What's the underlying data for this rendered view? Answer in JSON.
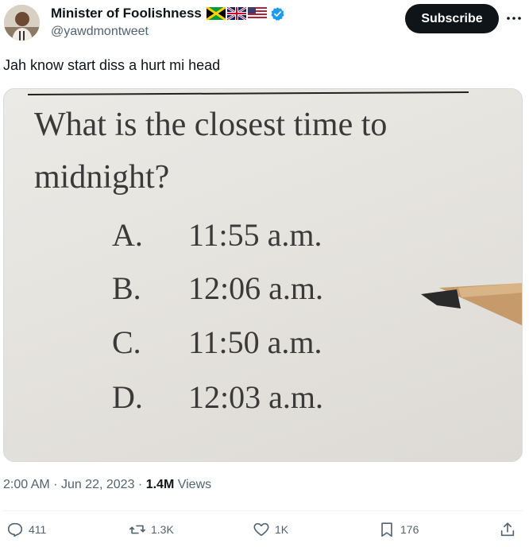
{
  "author": {
    "name": "Minister of Foolishness",
    "handle": "@yawdmontweet",
    "flags": [
      "jamaica-flag-icon",
      "uk-flag-icon",
      "us-flag-icon"
    ],
    "verified": true,
    "verified_color": "#1d9bf0"
  },
  "header": {
    "subscribe_label": "Subscribe"
  },
  "tweet": {
    "text": "Jah know start diss a hurt mi head"
  },
  "media": {
    "question_line1": "What is the closest time to",
    "question_line2": "midnight?",
    "options": [
      {
        "letter": "A.",
        "time": "11:55 a.m."
      },
      {
        "letter": "B.",
        "time": "12:06 a.m."
      },
      {
        "letter": "C.",
        "time": "11:50 a.m."
      },
      {
        "letter": "D.",
        "time": "12:03 a.m."
      }
    ]
  },
  "meta": {
    "time": "2:00 AM",
    "date": "Jun 22, 2023",
    "views_count": "1.4M",
    "views_label": "Views",
    "separator": "·"
  },
  "actions": {
    "replies": "411",
    "reposts": "1.3K",
    "likes": "1K",
    "bookmarks": "176"
  }
}
